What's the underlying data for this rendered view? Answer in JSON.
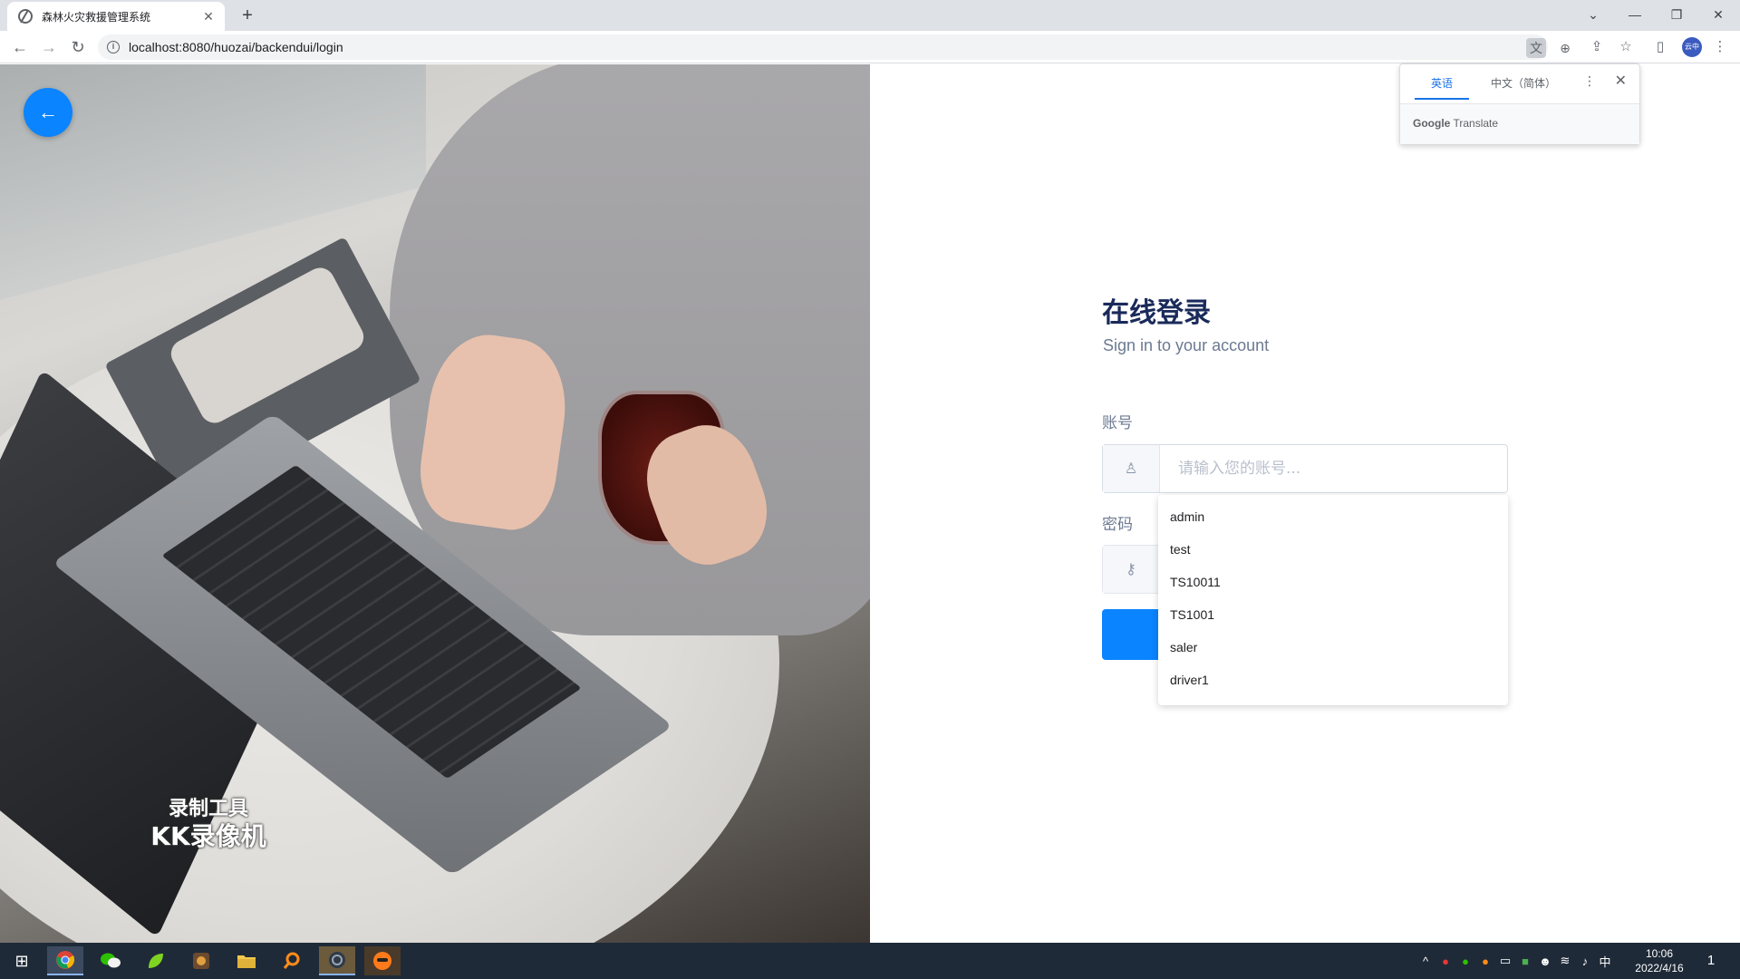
{
  "browser": {
    "tab_title": "森林火灾救援管理系统",
    "tab_close": "✕",
    "new_tab": "+",
    "url": "localhost:8080/huozai/backendui/login",
    "nav": {
      "back": "←",
      "forward": "→",
      "reload": "↻"
    },
    "window": {
      "chevron": "⌄",
      "minimize": "—",
      "restore": "❐",
      "close": "✕"
    },
    "profile_label": "云中",
    "toolbar_icons": {
      "translate": "文",
      "zoom": "⊕",
      "share": "⇪",
      "star": "☆",
      "sidebar": "▯",
      "menu": "⋮"
    }
  },
  "translate_popup": {
    "tab_source": "英语",
    "tab_target": "中文（简体）",
    "more": "⋮",
    "close": "✕",
    "footer_brand": "Google",
    "footer_product": "Translate"
  },
  "page": {
    "back_button": "←",
    "title": "在线登录",
    "subtitle": "Sign in to your account",
    "account_label": "账号",
    "account_placeholder": "请输入您的账号...",
    "password_label": "密码",
    "user_icon": "♙",
    "key_icon": "⚷"
  },
  "autocomplete": {
    "items": [
      "admin",
      "test",
      "TS10011",
      "TS1001",
      "saler",
      "driver1"
    ]
  },
  "watermark": {
    "line1": "录制工具",
    "line2": "KK录像机"
  },
  "taskbar": {
    "start": "⊞",
    "apps": [
      "chrome-icon",
      "wechat-icon",
      "green-app-icon",
      "game-app-icon",
      "file-explorer-icon",
      "search-app-icon",
      "settings-app-icon",
      "recorder-app-icon"
    ],
    "tray_up": "^",
    "ime": "中",
    "time": "10:06",
    "date": "2022/4/16",
    "notification": "1"
  }
}
